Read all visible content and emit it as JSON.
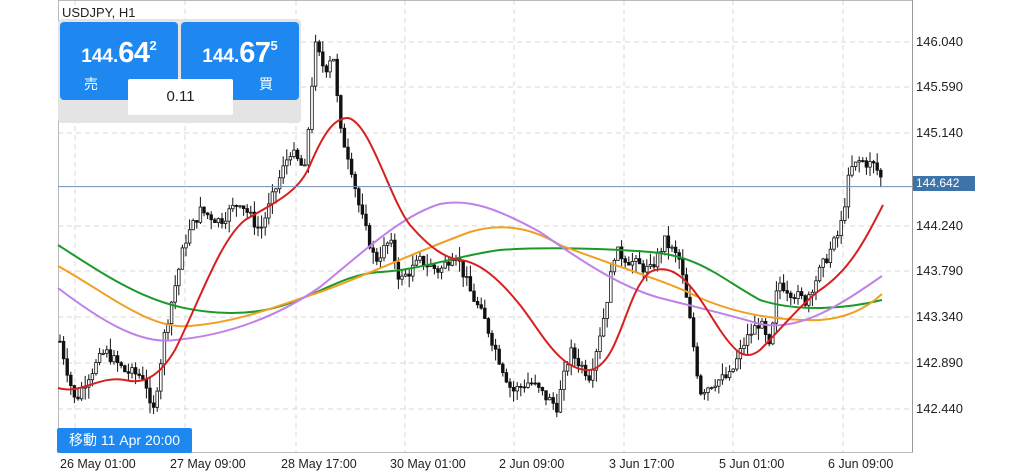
{
  "symbol": "USDJPY, H1",
  "sell": {
    "price_small": "144.",
    "price_big": "64",
    "price_sup": "2",
    "label": "売"
  },
  "buy": {
    "price_small": "144.",
    "price_big": "67",
    "price_sup": "5",
    "label": "買"
  },
  "spread": "0.11",
  "move_label": "移動 11 Apr 20:00",
  "current_price": "144.642",
  "y_axis": [
    "146.040",
    "145.590",
    "145.140",
    "144.240",
    "143.790",
    "143.340",
    "142.890",
    "142.440"
  ],
  "x_axis": [
    "26 May 01:00",
    "27 May 09:00",
    "28 May 17:00",
    "30 May 01:00",
    "2 Jun 09:00",
    "3 Jun 17:00",
    "5 Jun 01:00",
    "6 Jun 09:00"
  ],
  "colors": {
    "ma_fast": "#d62020",
    "ma_orange": "#f0a020",
    "ma_violet": "#c080e8",
    "ma_green": "#1a9a2a",
    "accent": "#1e88f0",
    "price_line": "#6e8fb5"
  },
  "icons": []
}
